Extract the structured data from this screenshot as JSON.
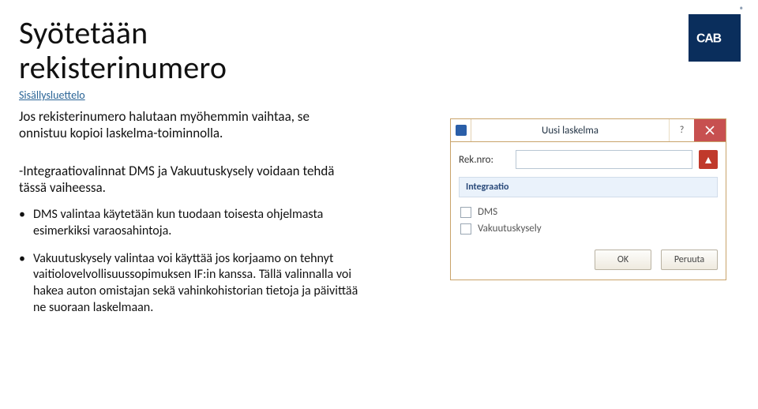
{
  "title_l1": "Syötetään",
  "title_l2": "rekisterinumero",
  "toc_label": "Sisällysluettelo",
  "lead": "Jos rekisterinumero halutaan myöhemmin vaihtaa, se onnistuu kopioi laskelma-toiminnolla.",
  "section_note": "-Integraatiovalinnat DMS ja Vakuutuskysely voidaan tehdä tässä vaiheessa.",
  "bullets": [
    "DMS valintaa käytetään kun tuodaan toisesta ohjelmasta esimerkiksi varaosahintoja.",
    "Vakuutuskysely valintaa voi käyttää jos korjaamo on tehnyt vaitiolovelvollisuussopimuksen IF:in kanssa. Tällä valinnalla voi hakea auton omistajan sekä vahinkohistorian tietoja ja päivittää ne suoraan laskelmaan."
  ],
  "logo_text": "CAB",
  "dialog": {
    "title": "Uusi laskelma",
    "help_glyph": "?",
    "reknro_label": "Rek.nro:",
    "reknro_value": "",
    "alert_glyph": "▲",
    "integration_header": "Integraatio",
    "options": [
      "DMS",
      "Vakuutuskysely"
    ],
    "ok_label": "OK",
    "cancel_label": "Peruuta"
  }
}
